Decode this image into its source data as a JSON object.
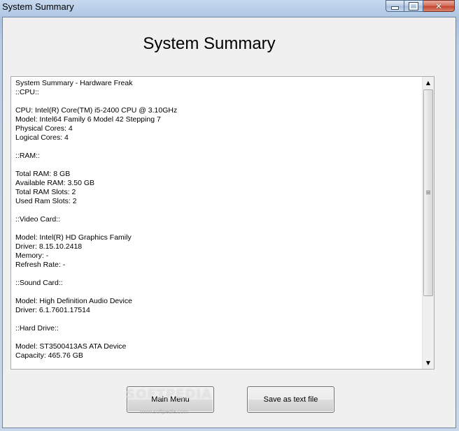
{
  "window": {
    "title": "System Summary"
  },
  "heading": "System Summary",
  "summary_lines": [
    "System Summary - Hardware Freak",
    "::CPU::",
    "",
    "CPU: Intel(R) Core(TM) i5-2400 CPU @ 3.10GHz",
    "Model: Intel64 Family 6 Model 42 Stepping 7",
    "Physical Cores: 4",
    "Logical Cores: 4",
    "",
    "::RAM::",
    "",
    "Total RAM: 8 GB",
    "Available RAM: 3.50 GB",
    "Total RAM Slots: 2",
    "Used Ram Slots: 2",
    "",
    "::Video Card::",
    "",
    "Model: Intel(R) HD Graphics Family",
    "Driver: 8.15.10.2418",
    "Memory: -",
    "Refresh Rate: -",
    "",
    "::Sound Card::",
    "",
    "Model: High Definition Audio Device",
    "Driver: 6.1.7601.17514",
    "",
    "::Hard Drive::",
    "",
    "Model: ST3500413AS ATA Device",
    "Capacity: 465.76 GB"
  ],
  "buttons": {
    "main_menu": "Main Menu",
    "save_text": "Save as text file"
  },
  "watermark": {
    "brand": "SOFTPEDIA",
    "url": "www.softpedia.com"
  },
  "icons": {
    "minimize": "minimize-icon",
    "maximize": "maximize-icon",
    "close": "close-icon",
    "scroll_up": "scroll-up-arrow-icon",
    "scroll_down": "scroll-down-arrow-icon"
  }
}
